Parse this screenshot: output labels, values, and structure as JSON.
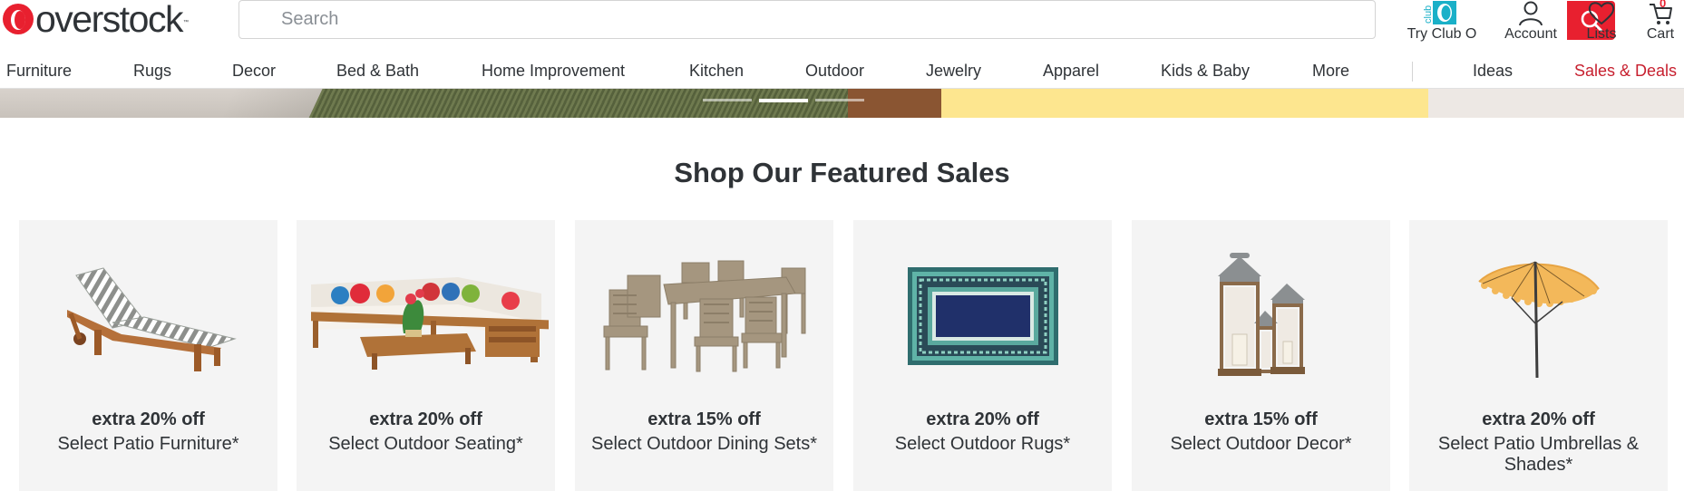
{
  "header": {
    "logo_text": "overstock",
    "logo_tm": "™",
    "search_placeholder": "Search",
    "club": {
      "badge": "club",
      "label": "Try Club O"
    },
    "account_label": "Account",
    "lists_label": "Lists",
    "cart_label": "Cart",
    "cart_count": "0"
  },
  "nav": {
    "items": [
      "Furniture",
      "Rugs",
      "Decor",
      "Bed & Bath",
      "Home Improvement",
      "Kitchen",
      "Outdoor",
      "Jewelry",
      "Apparel",
      "Kids & Baby",
      "More"
    ],
    "ideas": "Ideas",
    "sales": "Sales & Deals"
  },
  "hero": {
    "slide_count": 3,
    "active_slide": 2
  },
  "featured": {
    "title": "Shop Our Featured Sales",
    "cards": [
      {
        "deal": "extra 20% off",
        "label": "Select Patio Furniture*",
        "icon": "chaise-lounge"
      },
      {
        "deal": "extra 20% off",
        "label": "Select Outdoor Seating*",
        "icon": "sectional-sofa"
      },
      {
        "deal": "extra 15% off",
        "label": "Select Outdoor Dining Sets*",
        "icon": "dining-set"
      },
      {
        "deal": "extra 20% off",
        "label": "Select Outdoor Rugs*",
        "icon": "area-rug"
      },
      {
        "deal": "extra 15% off",
        "label": "Select Outdoor Decor*",
        "icon": "lanterns"
      },
      {
        "deal": "extra 20% off",
        "label": "Select Patio Umbrellas & Shades*",
        "icon": "patio-umbrella"
      }
    ]
  },
  "colors": {
    "brand_red": "#e8202f",
    "sales_red": "#c7202f",
    "text": "#2f3337",
    "card_bg": "#f4f4f4",
    "club_teal": "#1ab0c8",
    "hero_yellow": "#fde68f"
  }
}
